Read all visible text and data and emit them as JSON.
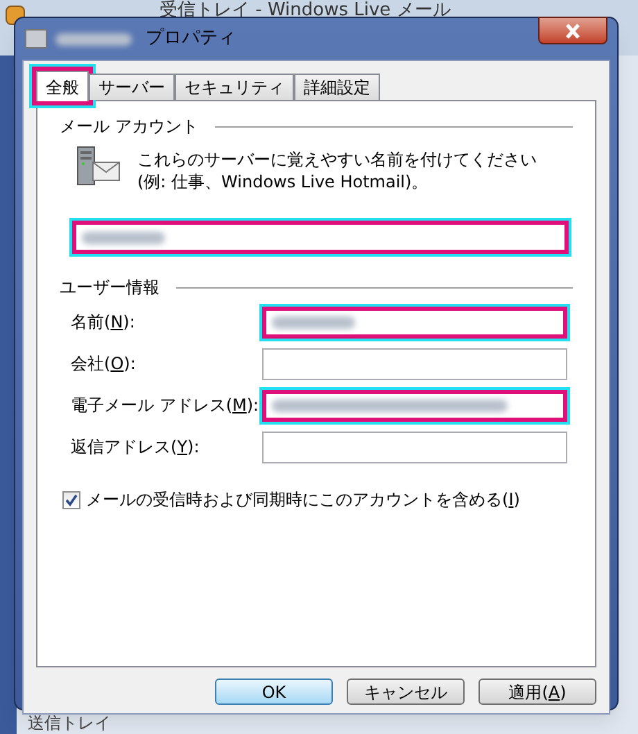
{
  "background_window": {
    "title": "受信トレイ - Windows Live メール",
    "folder": "送信トレイ"
  },
  "dialog": {
    "title": "プロパティ"
  },
  "tabs": [
    {
      "label": "全般",
      "selected": true,
      "highlighted": true
    },
    {
      "label": "サーバー",
      "selected": false,
      "highlighted": false
    },
    {
      "label": "セキュリティ",
      "selected": false,
      "highlighted": false
    },
    {
      "label": "詳細設定",
      "selected": false,
      "highlighted": false
    }
  ],
  "mail_account": {
    "heading": "メール アカウント",
    "description": "これらのサーバーに覚えやすい名前を付けてください (例: 仕事、Windows Live Hotmail)。",
    "name_field": {
      "redacted": true,
      "highlighted": true
    }
  },
  "user_info": {
    "heading": "ユーザー情報",
    "fields": [
      {
        "before": "名前(",
        "key": "N",
        "after": "):",
        "redacted": true,
        "highlighted": true
      },
      {
        "before": "会社(",
        "key": "O",
        "after": "):",
        "redacted": false,
        "highlighted": false
      },
      {
        "before": "電子メール アドレス(",
        "key": "M",
        "after": "):",
        "redacted": true,
        "highlighted": true
      },
      {
        "before": "返信アドレス(",
        "key": "Y",
        "after": "):",
        "redacted": false,
        "highlighted": false
      }
    ]
  },
  "include_checkbox": {
    "before": "メールの受信時および同期時にこのアカウントを含める(",
    "key": "I",
    "after": ")",
    "checked": true
  },
  "buttons": [
    {
      "before": "OK",
      "default": true
    },
    {
      "before": "キャンセル",
      "default": false
    },
    {
      "before": "適用(",
      "key": "A",
      "after": ")",
      "default": false
    }
  ]
}
